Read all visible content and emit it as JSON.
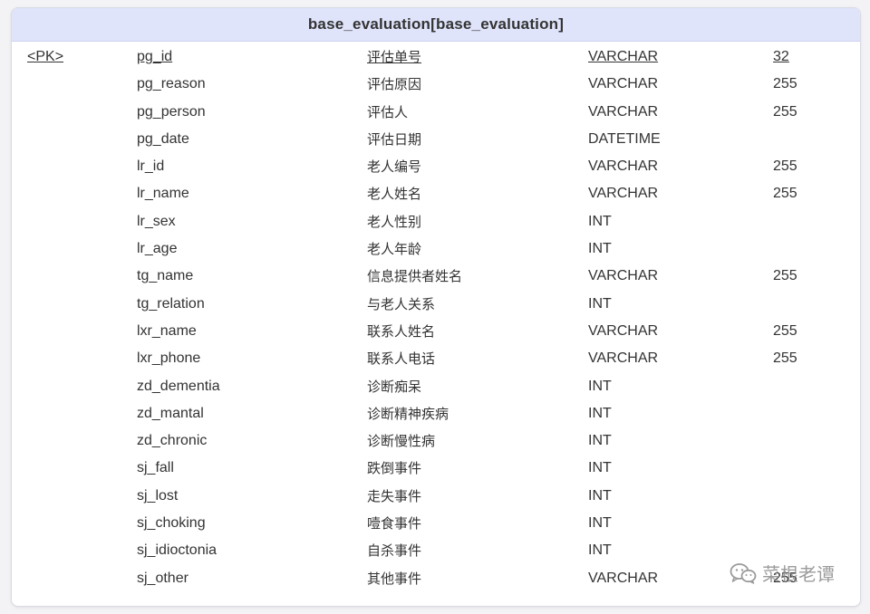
{
  "entity": {
    "title": "base_evaluation[base_evaluation]",
    "columns": [
      {
        "key": "<PK>",
        "name": "pg_id",
        "comment": "评估单号",
        "type": "VARCHAR",
        "length": "32"
      },
      {
        "key": "",
        "name": "pg_reason",
        "comment": "评估原因",
        "type": "VARCHAR",
        "length": "255"
      },
      {
        "key": "",
        "name": "pg_person",
        "comment": "评估人",
        "type": "VARCHAR",
        "length": "255"
      },
      {
        "key": "",
        "name": "pg_date",
        "comment": "评估日期",
        "type": "DATETIME",
        "length": ""
      },
      {
        "key": "",
        "name": "lr_id",
        "comment": "老人编号",
        "type": "VARCHAR",
        "length": "255"
      },
      {
        "key": "",
        "name": "lr_name",
        "comment": "老人姓名",
        "type": "VARCHAR",
        "length": "255"
      },
      {
        "key": "",
        "name": "lr_sex",
        "comment": "老人性别",
        "type": "INT",
        "length": ""
      },
      {
        "key": "",
        "name": "lr_age",
        "comment": "老人年龄",
        "type": "INT",
        "length": ""
      },
      {
        "key": "",
        "name": "tg_name",
        "comment": "信息提供者姓名",
        "type": "VARCHAR",
        "length": "255"
      },
      {
        "key": "",
        "name": "tg_relation",
        "comment": "与老人关系",
        "type": "INT",
        "length": ""
      },
      {
        "key": "",
        "name": "lxr_name",
        "comment": "联系人姓名",
        "type": "VARCHAR",
        "length": "255"
      },
      {
        "key": "",
        "name": "lxr_phone",
        "comment": "联系人电话",
        "type": "VARCHAR",
        "length": "255"
      },
      {
        "key": "",
        "name": "zd_dementia",
        "comment": "诊断痴呆",
        "type": "INT",
        "length": ""
      },
      {
        "key": "",
        "name": "zd_mantal",
        "comment": "诊断精神疾病",
        "type": "INT",
        "length": ""
      },
      {
        "key": "",
        "name": "zd_chronic",
        "comment": "诊断慢性病",
        "type": "INT",
        "length": ""
      },
      {
        "key": "",
        "name": "sj_fall",
        "comment": "跌倒事件",
        "type": "INT",
        "length": ""
      },
      {
        "key": "",
        "name": "sj_lost",
        "comment": "走失事件",
        "type": "INT",
        "length": ""
      },
      {
        "key": "",
        "name": "sj_choking",
        "comment": "噎食事件",
        "type": "INT",
        "length": ""
      },
      {
        "key": "",
        "name": "sj_idioctonia",
        "comment": "自杀事件",
        "type": "INT",
        "length": ""
      },
      {
        "key": "",
        "name": "sj_other",
        "comment": "其他事件",
        "type": "VARCHAR",
        "length": "255"
      }
    ]
  },
  "watermark": {
    "icon": "wechat-icon",
    "text": "菜根老谭"
  },
  "colors": {
    "header_bg": "#e0e4fb",
    "text": "#333333",
    "page_bg": "#f3f3f5"
  }
}
